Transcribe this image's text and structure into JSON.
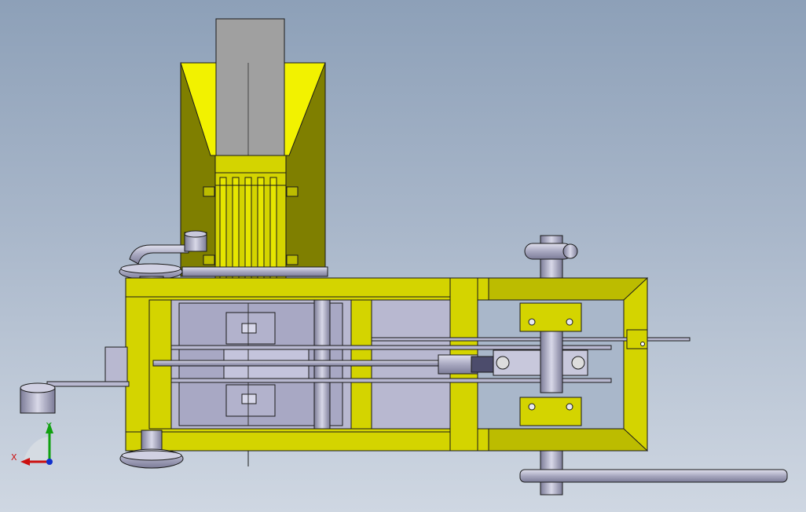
{
  "viewport": {
    "background_top": "#8da0b8",
    "background_bottom": "#cfd7e2"
  },
  "colors": {
    "frame_yellow": "#d4d400",
    "hopper_dark": "#7f7f00",
    "hopper_light": "#f2f200",
    "chute_gray": "#a0a0a0",
    "part_lavender": "#b8b8d0",
    "outline": "#1a1a1a"
  },
  "triad": {
    "x_label": "X",
    "y_label": "Y",
    "x_color": "#cc1010",
    "y_color": "#10a010",
    "z_color": "#1030cc"
  }
}
